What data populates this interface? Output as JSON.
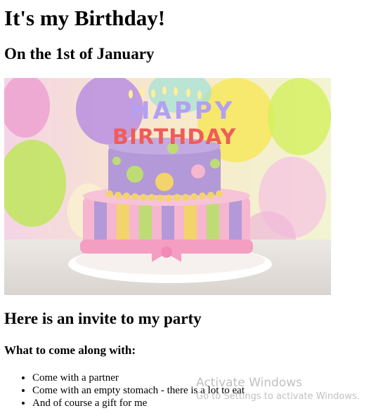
{
  "page": {
    "title": "It's my Birthday!",
    "subtitle": "On the 1st of January",
    "invite_heading": "Here is an invite to my party",
    "bring_heading": "What to come along with:",
    "items": [
      "Come with a partner",
      "Come with an empty stomach - there is a lot to eat",
      "And of course a gift for me"
    ]
  },
  "cake_image": {
    "candle_text_top": "HAPPY",
    "candle_text_bottom": "BIRTHDAY",
    "colors": {
      "purple": "#b399d8",
      "pink": "#f6b6cf",
      "yellow": "#f2d46a",
      "green": "#bedc74"
    }
  },
  "watermark": {
    "line1": "Activate Windows",
    "line2": "Go to Settings to activate Windows."
  }
}
